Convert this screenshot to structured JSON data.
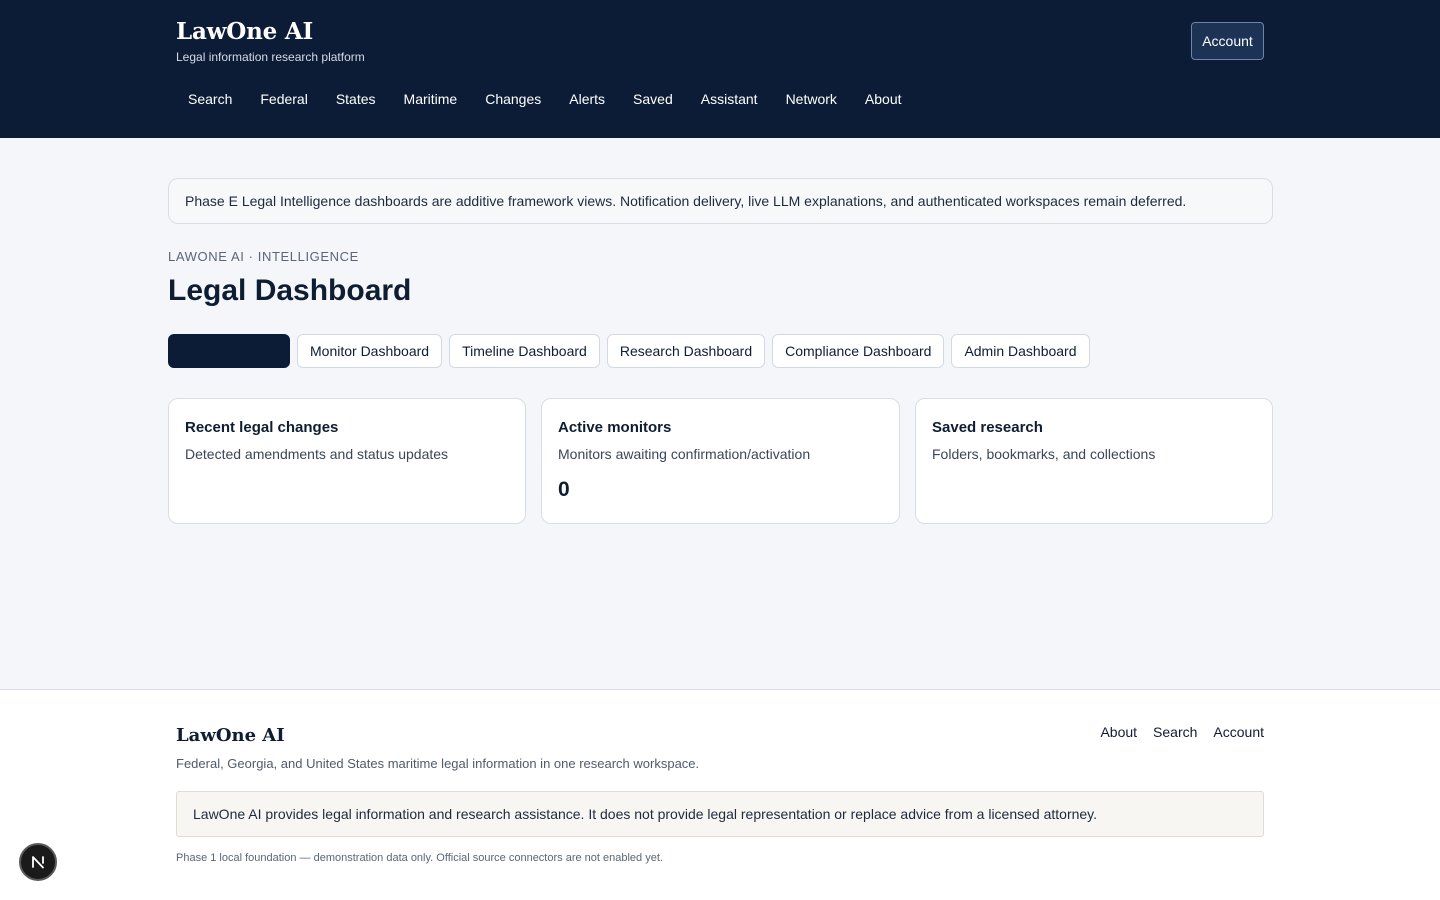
{
  "header": {
    "brand": "LawOne AI",
    "tagline": "Legal information research platform",
    "account_label": "Account",
    "nav": [
      "Search",
      "Federal",
      "States",
      "Maritime",
      "Changes",
      "Alerts",
      "Saved",
      "Assistant",
      "Network",
      "About"
    ]
  },
  "notice": "Phase E Legal Intelligence dashboards are additive framework views. Notification delivery, live LLM explanations, and authenticated workspaces remain deferred.",
  "eyebrow": "LAWONE AI · INTELLIGENCE",
  "page_title": "Legal Dashboard",
  "tabs": {
    "active": "",
    "items": [
      "Monitor Dashboard",
      "Timeline Dashboard",
      "Research Dashboard",
      "Compliance Dashboard",
      "Admin Dashboard"
    ]
  },
  "cards": [
    {
      "title": "Recent legal changes",
      "subtitle": "Detected amendments and status updates",
      "value": ""
    },
    {
      "title": "Active monitors",
      "subtitle": "Monitors awaiting confirmation/activation",
      "value": "0"
    },
    {
      "title": "Saved research",
      "subtitle": "Folders, bookmarks, and collections",
      "value": ""
    }
  ],
  "footer": {
    "brand": "LawOne AI",
    "tagline": "Federal, Georgia, and United States maritime legal information in one research workspace.",
    "links": [
      "About",
      "Search",
      "Account"
    ],
    "disclaimer": "LawOne AI provides legal information and research assistance. It does not provide legal representation or replace advice from a licensed attorney.",
    "phase_note": "Phase 1 local foundation — demonstration data only. Official source connectors are not enabled yet."
  },
  "dev_badge": {
    "icon": "n-logo-icon"
  }
}
